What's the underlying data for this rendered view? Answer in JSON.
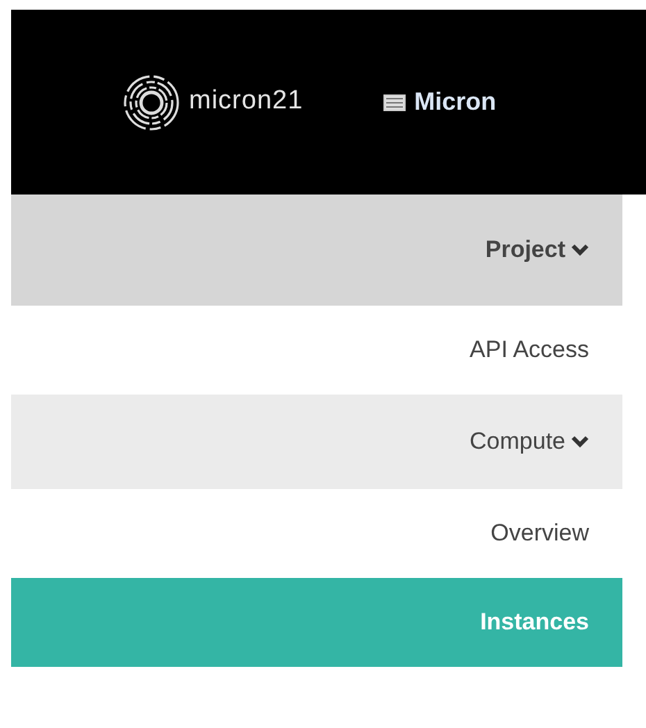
{
  "header": {
    "logo_text": "micron21",
    "project_menu": "Micron"
  },
  "sidebar": {
    "items": [
      {
        "kind": "group",
        "label": "Project",
        "expanded": true,
        "selected": false
      },
      {
        "kind": "link",
        "label": "API Access",
        "selected": false
      },
      {
        "kind": "group",
        "label": "Compute",
        "expanded": true,
        "selected": false
      },
      {
        "kind": "link",
        "label": "Overview",
        "selected": false
      },
      {
        "kind": "link",
        "label": "Instances",
        "selected": true
      }
    ]
  }
}
